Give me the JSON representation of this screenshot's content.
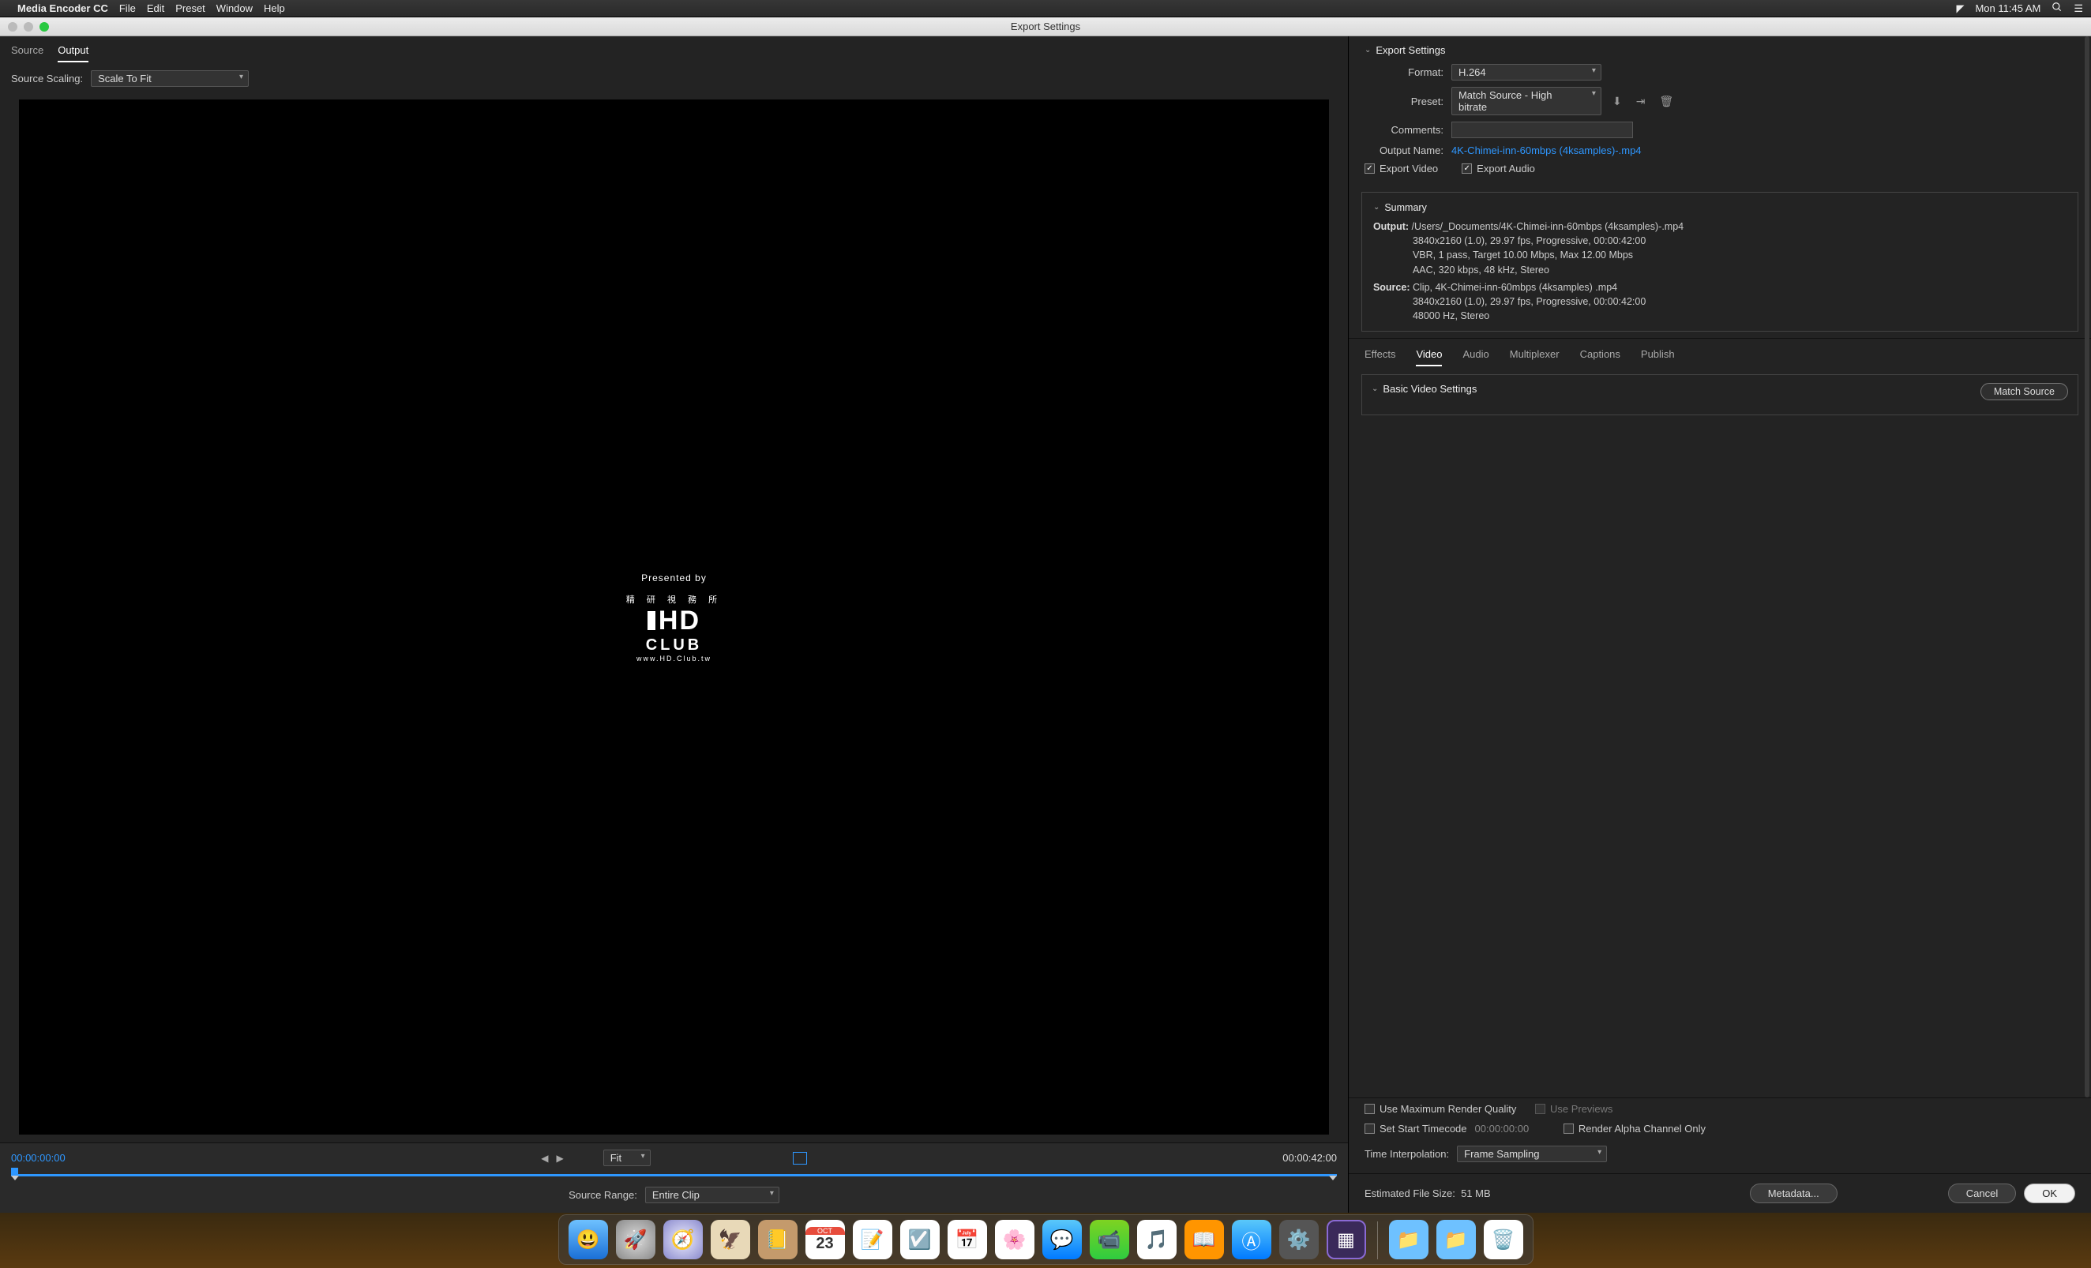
{
  "menubar": {
    "app": "Media Encoder CC",
    "items": [
      "File",
      "Edit",
      "Preset",
      "Window",
      "Help"
    ],
    "clock": "Mon 11:45 AM"
  },
  "window": {
    "title": "Export Settings"
  },
  "left": {
    "tabs": {
      "source": "Source",
      "output": "Output"
    },
    "scaling_label": "Source Scaling:",
    "scaling_value": "Scale To Fit",
    "preview": {
      "presented": "Presented by",
      "cjk": "精  研  視  務  所",
      "hd": "HD",
      "club": "CLUB",
      "url": "www.HD.Club.tw"
    },
    "transport": {
      "start_tc": "00:00:00:00",
      "end_tc": "00:00:42:00",
      "zoom": "Fit",
      "src_range_label": "Source Range:",
      "src_range_value": "Entire Clip"
    }
  },
  "right": {
    "section_title": "Export Settings",
    "format_label": "Format:",
    "format_value": "H.264",
    "preset_label": "Preset:",
    "preset_value": "Match Source - High bitrate",
    "comments_label": "Comments:",
    "comments_value": "",
    "outname_label": "Output Name:",
    "outname_value": "4K-Chimei-inn-60mbps (4ksamples)-.mp4",
    "export_video": "Export Video",
    "export_audio": "Export Audio",
    "summary_title": "Summary",
    "summary": {
      "output_label": "Output:",
      "output_path": "/Users/_Documents/4K-Chimei-inn-60mbps (4ksamples)-.mp4",
      "output_l2": "3840x2160 (1.0), 29.97 fps, Progressive, 00:00:42:00",
      "output_l3": "VBR, 1 pass, Target 10.00 Mbps, Max 12.00 Mbps",
      "output_l4": "AAC, 320 kbps, 48 kHz, Stereo",
      "source_label": "Source:",
      "source_path": "Clip, 4K-Chimei-inn-60mbps (4ksamples) .mp4",
      "source_l2": "3840x2160 (1.0), 29.97 fps, Progressive, 00:00:42:00",
      "source_l3": "48000 Hz, Stereo"
    },
    "tabs": [
      "Effects",
      "Video",
      "Audio",
      "Multiplexer",
      "Captions",
      "Publish"
    ],
    "bvs_title": "Basic Video Settings",
    "match_source": "Match Source",
    "opts": {
      "max_quality": "Use Maximum Render Quality",
      "use_previews": "Use Previews",
      "set_start_tc": "Set Start Timecode",
      "set_start_tc_val": "00:00:00:00",
      "render_alpha": "Render Alpha Channel Only",
      "time_interp_label": "Time Interpolation:",
      "time_interp_value": "Frame Sampling"
    },
    "est_label": "Estimated File Size:",
    "est_value": "51 MB",
    "metadata": "Metadata...",
    "cancel": "Cancel",
    "ok": "OK"
  },
  "dock": {
    "apps": [
      "finder",
      "launchpad",
      "safari",
      "mail",
      "contacts",
      "calendar",
      "notes",
      "reminders",
      "photos-app",
      "photos",
      "messages",
      "facetime",
      "itunes",
      "ibooks",
      "appstore",
      "settings",
      "media-encoder"
    ],
    "cal_month": "OCT",
    "cal_day": "23"
  }
}
